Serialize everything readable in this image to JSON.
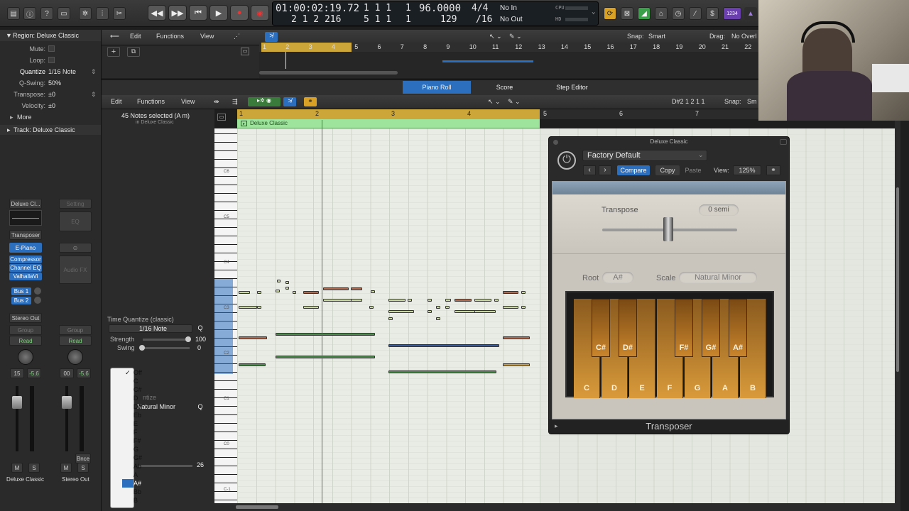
{
  "control_bar": {
    "time": "01:00:02:19.72",
    "subframes": "2 1 2 216",
    "bars": "1 1 1",
    "bars2": "5 1 1",
    "beat_a": "1",
    "beat_b": "1",
    "tempo": "96.0000",
    "tempo2": "129",
    "sig_top": "4/4",
    "sig_bottom": "/16",
    "in_label": "No In",
    "out_label": "No Out",
    "cpu": "CPU",
    "hd": "HD",
    "user_badge": "1234"
  },
  "inspector": {
    "region_header": "Region: Deluxe Classic",
    "mute_label": "Mute:",
    "loop_label": "Loop:",
    "quantize_label": "Quantize",
    "quantize_value": "1/16 Note",
    "qswing_label": "Q-Swing:",
    "qswing_value": "50%",
    "transpose_label": "Transpose:",
    "transpose_value": "±0",
    "velocity_label": "Velocity:",
    "velocity_value": "±0",
    "more_label": "More",
    "track_header": "Track: Deluxe Classic",
    "strip1": {
      "name": "Deluxe Cl...",
      "midi_fx": "Transposer",
      "instrument": "E-Piano",
      "fx1": "Compressor",
      "fx2": "Channel EQ",
      "fx3": "ValhallaVi",
      "send1": "Bus 1",
      "send2": "Bus 2",
      "output": "Stereo Out",
      "group": "Group",
      "automation": "Read",
      "vol": "15",
      "pan": "-5.6",
      "mute": "M",
      "solo": "S",
      "label": "Deluxe Classic"
    },
    "strip2": {
      "setting": "Setting",
      "eq": "EQ",
      "audio_fx": "Audio FX",
      "group": "Group",
      "automation": "Read",
      "vol": "00",
      "pan": "-5.6",
      "bnce": "Bnce",
      "mute": "M",
      "solo": "S",
      "label": "Stereo Out"
    }
  },
  "tracks_area": {
    "edit_menu": "Edit",
    "functions_menu": "Functions",
    "view_menu": "View",
    "snap_label": "Snap:",
    "snap_value": "Smart",
    "drag_label": "Drag:",
    "drag_value": "No Overl",
    "ruler": [
      "1",
      "2",
      "3",
      "4",
      "5",
      "6",
      "7",
      "8",
      "9",
      "10",
      "11",
      "12",
      "13",
      "14",
      "15",
      "16",
      "17",
      "18",
      "19",
      "20",
      "21",
      "22"
    ]
  },
  "editor_tabs": {
    "piano_roll": "Piano Roll",
    "score": "Score",
    "step_editor": "Step Editor"
  },
  "piano_roll": {
    "edit_menu": "Edit",
    "functions_menu": "Functions",
    "view_menu": "View",
    "position": "D#2  1 2 1 1",
    "snap_label": "Snap:",
    "snap_value": "Sm",
    "selection_info": "45 Notes selected (A m)",
    "selection_sub": "in Deluxe Classic",
    "region_name": "Deluxe Classic",
    "ruler": [
      "1",
      "2",
      "3",
      "4",
      "5",
      "6",
      "7"
    ],
    "key_labels": [
      "C6",
      "C5",
      "C4",
      "C3",
      "C2",
      "C1",
      "C0",
      "C-1"
    ],
    "time_quantize_label": "Time Quantize (classic)",
    "time_quantize_value": "1/16 Note",
    "q_button": "Q",
    "strength_label": "Strength",
    "strength_value": "100",
    "swing_label": "Swing",
    "swing_value": "0",
    "scale_quantize_label": "ntize",
    "scale_value": "Natural Minor",
    "velocity_value": "26"
  },
  "root_dropdown": {
    "items": [
      "Off",
      "C",
      "C#",
      "D",
      "D#",
      "Eb",
      "E",
      "F",
      "F#",
      "G",
      "G#",
      "Ab",
      "A",
      "A#",
      "Bb",
      "B"
    ],
    "checked": "Off",
    "highlighted": "A#"
  },
  "plugin": {
    "window_title": "Deluxe Classic",
    "preset": "Factory Default",
    "compare": "Compare",
    "copy": "Copy",
    "paste": "Paste",
    "view_label": "View:",
    "view_value": "125%",
    "transpose_label": "Transpose",
    "transpose_value": "0 semi",
    "root_label": "Root",
    "root_value": "A#",
    "scale_label": "Scale",
    "scale_value": "Natural Minor",
    "white_keys": [
      "C",
      "D",
      "E",
      "F",
      "G",
      "A",
      "B"
    ],
    "black_keys": [
      "C#",
      "D#",
      "F#",
      "G#",
      "A#"
    ],
    "name": "Transposer"
  }
}
